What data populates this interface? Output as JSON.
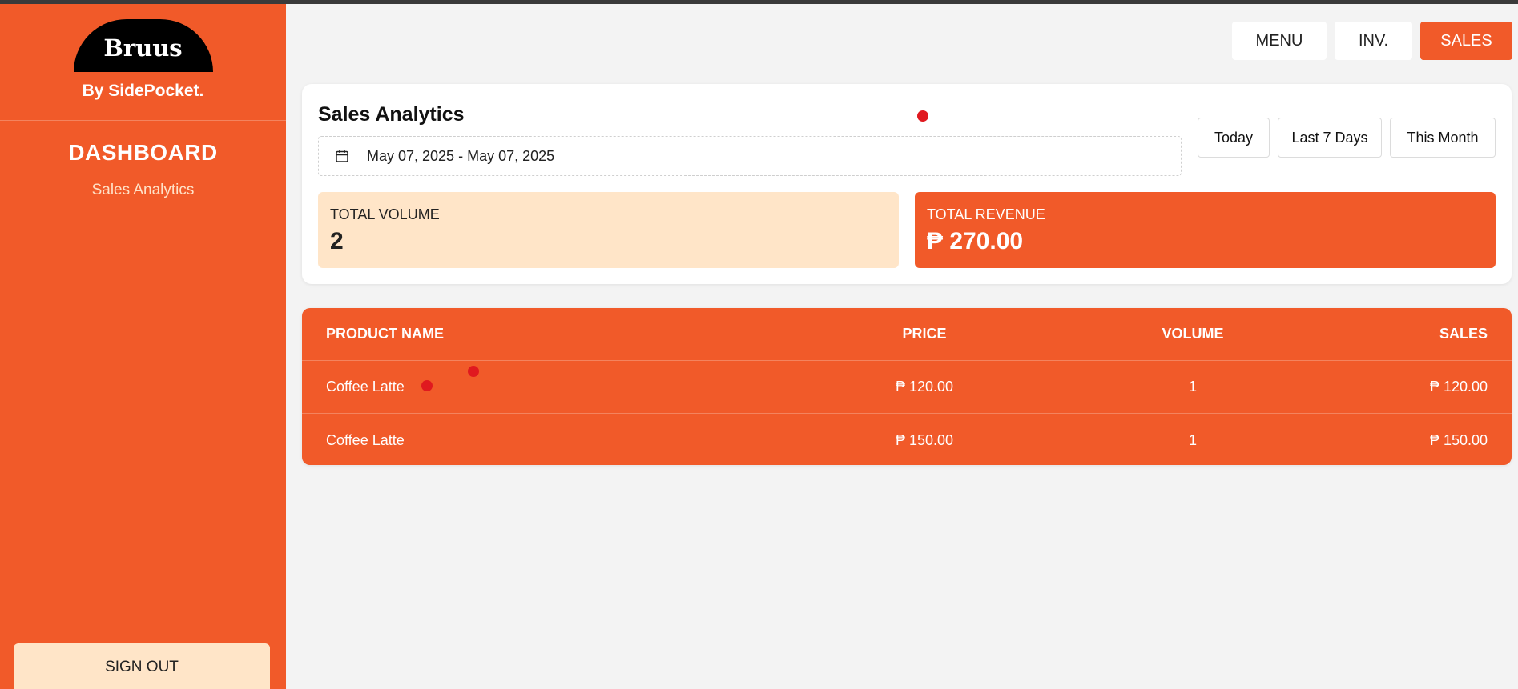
{
  "sidebar": {
    "logo_text": "Bruus",
    "subtitle": "By SidePocket.",
    "section_title": "DASHBOARD",
    "links": [
      {
        "label": "Sales Analytics"
      }
    ],
    "signout_label": "SIGN OUT"
  },
  "topnav": {
    "menu_label": "MENU",
    "inv_label": "INV.",
    "sales_label": "SALES"
  },
  "analytics": {
    "title": "Sales Analytics",
    "date_range": "May 07, 2025 - May 07, 2025",
    "range_buttons": {
      "today": "Today",
      "last7": "Last 7 Days",
      "month": "This Month"
    },
    "total_volume_label": "TOTAL VOLUME",
    "total_volume_value": "2",
    "total_revenue_label": "TOTAL REVENUE",
    "total_revenue_value": "₱ 270.00"
  },
  "table": {
    "headers": {
      "name": "PRODUCT NAME",
      "price": "PRICE",
      "volume": "VOLUME",
      "sales": "SALES"
    },
    "rows": [
      {
        "name": "Coffee Latte",
        "price": "₱ 120.00",
        "volume": "1",
        "sales": "₱ 120.00"
      },
      {
        "name": "Coffee Latte",
        "price": "₱ 150.00",
        "volume": "1",
        "sales": "₱ 150.00"
      }
    ]
  },
  "colors": {
    "accent": "#f15a29",
    "cream": "#ffe5c8",
    "marker": "#e0191f"
  }
}
